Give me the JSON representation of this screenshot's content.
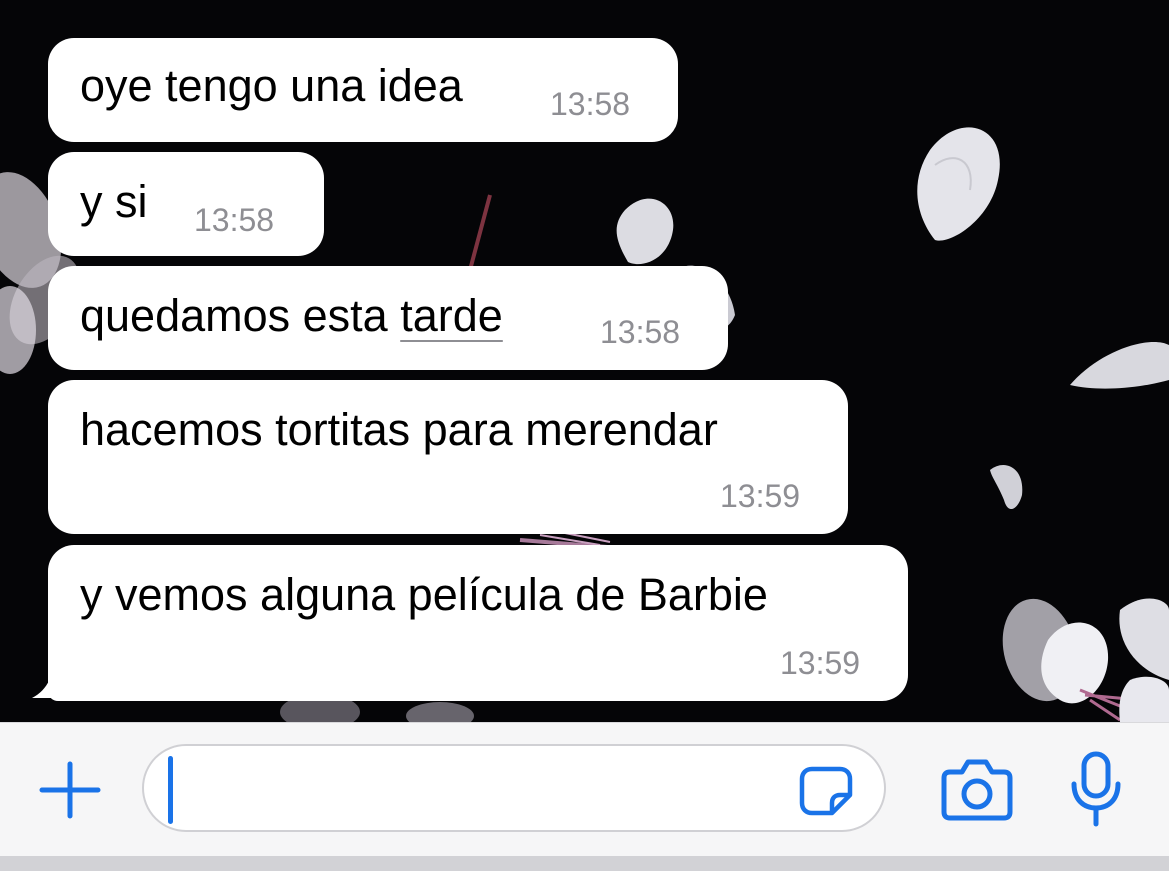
{
  "messages": [
    {
      "text": "oye tengo una idea",
      "time": "13:58"
    },
    {
      "text": "y si",
      "time": "13:58"
    },
    {
      "text_before": "quedamos esta ",
      "text_link": "tarde",
      "time": "13:58"
    },
    {
      "text": "hacemos tortitas para merendar",
      "time": "13:59"
    },
    {
      "text": "y vemos alguna película de Barbie",
      "time": "13:59"
    }
  ],
  "composer": {
    "input_value": "",
    "icons": [
      "plus-icon",
      "sticker-icon",
      "camera-icon",
      "microphone-icon"
    ],
    "accent_color": "#1a73e8"
  },
  "colors": {
    "bubble": "#ffffff",
    "timestamp": "#8e8e93",
    "wallpaper": "#050507"
  }
}
